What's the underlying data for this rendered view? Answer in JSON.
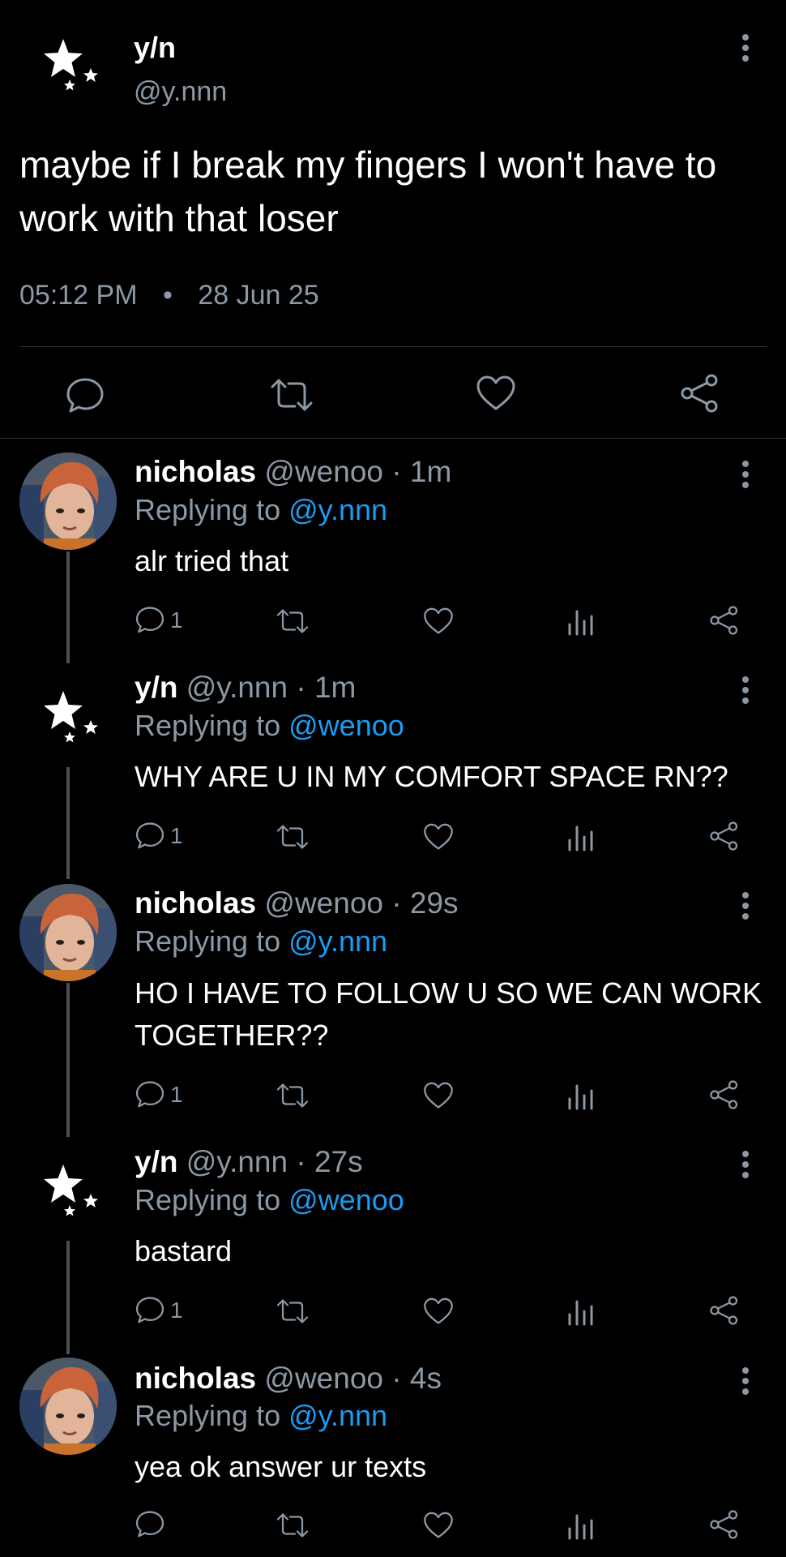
{
  "main_tweet": {
    "name": "y/n",
    "handle": "@y.nnn",
    "text": "maybe if I break my fingers I won't have to work with that loser",
    "time": "05:12 PM",
    "separator": "•",
    "date": "28 Jun 25"
  },
  "replies": [
    {
      "name": "nicholas",
      "handle": "@wenoo",
      "age": "· 1m",
      "replying_label": "Replying to",
      "replying_to": "@y.nnn",
      "text": "alr tried that",
      "reply_count": "1"
    },
    {
      "name": "y/n",
      "handle": "@y.nnn",
      "age": "· 1m",
      "replying_label": "Replying to",
      "replying_to": "@wenoo",
      "text": "WHY ARE U IN MY COMFORT SPACE RN??",
      "reply_count": "1"
    },
    {
      "name": "nicholas",
      "handle": "@wenoo",
      "age": "· 29s",
      "replying_label": "Replying to",
      "replying_to": "@y.nnn",
      "text": "HO I HAVE TO FOLLOW U SO WE CAN WORK TOGETHER??",
      "reply_count": "1"
    },
    {
      "name": "y/n",
      "handle": "@y.nnn",
      "age": "· 27s",
      "replying_label": "Replying to",
      "replying_to": "@wenoo",
      "text": "bastard",
      "reply_count": "1"
    },
    {
      "name": "nicholas",
      "handle": "@wenoo",
      "age": "· 4s",
      "replying_label": "Replying to",
      "replying_to": "@y.nnn",
      "text": "yea ok answer ur texts",
      "reply_count": ""
    }
  ],
  "icons": {
    "reply": "reply-icon",
    "retweet": "retweet-icon",
    "like": "heart-icon",
    "views": "views-icon",
    "share": "share-icon",
    "more": "more-vertical-icon",
    "star_avatar": "stars-avatar-icon"
  },
  "colors": {
    "background": "#000000",
    "muted": "#8b98a5",
    "link": "#1d9bf0",
    "divider": "#2f3336"
  }
}
